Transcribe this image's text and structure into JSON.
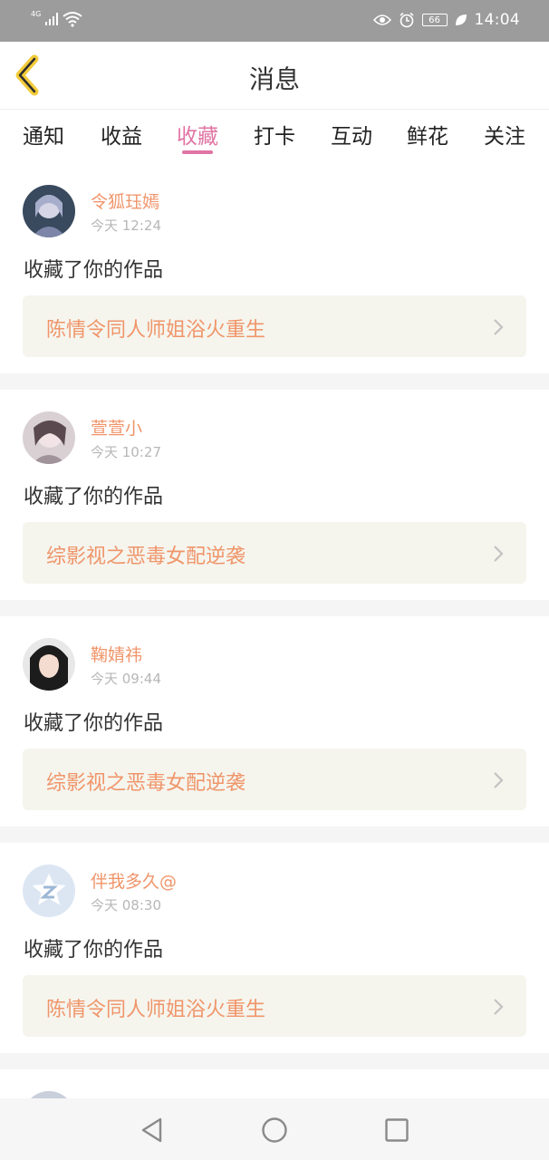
{
  "status_bar": {
    "network": "4G",
    "battery": "66",
    "time": "14:04"
  },
  "header": {
    "title": "消息"
  },
  "tabs": [
    {
      "label": "通知"
    },
    {
      "label": "收益"
    },
    {
      "label": "收藏"
    },
    {
      "label": "打卡"
    },
    {
      "label": "互动"
    },
    {
      "label": "鲜花"
    },
    {
      "label": "关注"
    }
  ],
  "active_tab": "收藏",
  "messages": [
    {
      "user": "令狐珏嫣",
      "time": "今天 12:24",
      "action": "收藏了你的作品",
      "work": "陈情令同人师姐浴火重生"
    },
    {
      "user": "萱萱小",
      "time": "今天 10:27",
      "action": "收藏了你的作品",
      "work": "综影视之恶毒女配逆袭"
    },
    {
      "user": "鞠婧祎",
      "time": "今天 09:44",
      "action": "收藏了你的作品",
      "work": "综影视之恶毒女配逆袭"
    },
    {
      "user": "伴我多久@",
      "time": "今天 08:30",
      "action": "收藏了你的作品",
      "work": "陈情令同人师姐浴火重生"
    }
  ],
  "colors": {
    "accent": "#e074a4",
    "name_orange": "#f0956a",
    "status_bar": "#9c9c9c",
    "work_bg": "#f5f5ee"
  }
}
